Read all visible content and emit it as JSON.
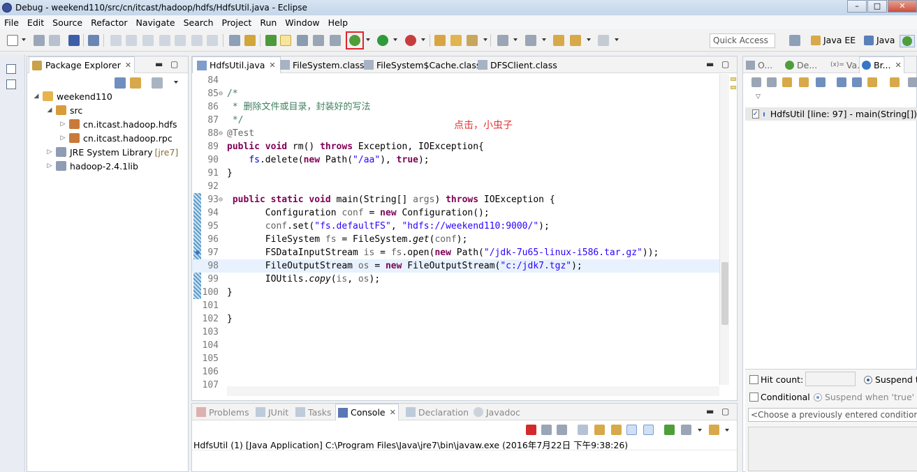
{
  "window": {
    "title": "Debug - weekend110/src/cn/itcast/hadoop/hdfs/HdfsUtil.java - Eclipse"
  },
  "menu": [
    "File",
    "Edit",
    "Source",
    "Refactor",
    "Navigate",
    "Search",
    "Project",
    "Run",
    "Window",
    "Help"
  ],
  "toolbar": {
    "quick_access_placeholder": "Quick Access",
    "perspectives": [
      "Java EE",
      "Java"
    ]
  },
  "package_explorer": {
    "tab_label": "Package Explorer",
    "tree": [
      {
        "label": "weekend110",
        "decor": ""
      },
      {
        "label": "src",
        "decor": ""
      },
      {
        "label": "cn.itcast.hadoop.hdfs",
        "decor": ""
      },
      {
        "label": "cn.itcast.hadoop.rpc",
        "decor": ""
      },
      {
        "label": "JRE System Library",
        "decor": "[jre7]"
      },
      {
        "label": "hadoop-2.4.1lib",
        "decor": ""
      }
    ]
  },
  "editor": {
    "tabs": [
      "HdfsUtil.java",
      "FileSystem.class",
      "FileSystem$Cache.class",
      "DFSClient.class"
    ],
    "annotation": "点击，小虫子",
    "lines": [
      {
        "n": "84",
        "fold": "",
        "code": []
      },
      {
        "n": "85",
        "fold": "⊖",
        "code": [
          [
            "cm",
            "/*"
          ]
        ]
      },
      {
        "n": "86",
        "fold": "",
        "code": [
          [
            "cm",
            " * 删除文件或目录，封装好的写法"
          ]
        ]
      },
      {
        "n": "87",
        "fold": "",
        "code": [
          [
            "cm",
            " */"
          ]
        ]
      },
      {
        "n": "88",
        "fold": "⊖",
        "code": [
          [
            "an",
            "@Test"
          ]
        ]
      },
      {
        "n": "89",
        "fold": "",
        "code": [
          [
            "kw",
            "public"
          ],
          [
            "",
            " "
          ],
          [
            "kw",
            "void"
          ],
          [
            "",
            " rm() "
          ],
          [
            "kw",
            "throws"
          ],
          [
            "",
            " Exception, IOException{"
          ]
        ]
      },
      {
        "n": "90",
        "fold": "",
        "code": [
          [
            "",
            "    "
          ],
          [
            "fld",
            "fs"
          ],
          [
            "",
            ".delete("
          ],
          [
            "kw",
            "new"
          ],
          [
            "",
            " Path("
          ],
          [
            "str",
            "\"/aa\""
          ],
          [
            "",
            "), "
          ],
          [
            "kw",
            "true"
          ],
          [
            "",
            ");"
          ]
        ]
      },
      {
        "n": "91",
        "fold": "",
        "code": [
          [
            "",
            "}"
          ]
        ]
      },
      {
        "n": "92",
        "fold": "",
        "code": []
      },
      {
        "n": "93",
        "fold": "⊖",
        "code": [
          [
            "",
            " "
          ],
          [
            "kw",
            "public"
          ],
          [
            "",
            " "
          ],
          [
            "kw",
            "static"
          ],
          [
            "",
            " "
          ],
          [
            "kw",
            "void"
          ],
          [
            "",
            " main(String[] "
          ],
          [
            "an",
            "args"
          ],
          [
            "",
            ") "
          ],
          [
            "kw",
            "throws"
          ],
          [
            "",
            " IOException {"
          ]
        ]
      },
      {
        "n": "94",
        "fold": "",
        "code": [
          [
            "",
            "       Configuration "
          ],
          [
            "an",
            "conf"
          ],
          [
            "",
            " = "
          ],
          [
            "kw",
            "new"
          ],
          [
            "",
            " Configuration();"
          ]
        ]
      },
      {
        "n": "95",
        "fold": "",
        "code": [
          [
            "",
            "       "
          ],
          [
            "an",
            "conf"
          ],
          [
            "",
            ".set("
          ],
          [
            "str",
            "\"fs.defaultFS\""
          ],
          [
            "",
            ", "
          ],
          [
            "str",
            "\"hdfs://weekend110:9000/\""
          ],
          [
            "",
            ");"
          ]
        ]
      },
      {
        "n": "96",
        "fold": "",
        "code": [
          [
            "",
            "       FileSystem "
          ],
          [
            "an",
            "fs"
          ],
          [
            "",
            " = FileSystem."
          ],
          [
            "it",
            "get"
          ],
          [
            "",
            "("
          ],
          [
            "an",
            "conf"
          ],
          [
            "",
            ");"
          ]
        ]
      },
      {
        "n": "97",
        "fold": "",
        "code": [
          [
            "",
            "       FSDataInputStream "
          ],
          [
            "an",
            "is"
          ],
          [
            "",
            " = "
          ],
          [
            "an",
            "fs"
          ],
          [
            "",
            ".open("
          ],
          [
            "kw",
            "new"
          ],
          [
            "",
            " Path("
          ],
          [
            "str",
            "\"/jdk-7u65-linux-i586.tar.gz\""
          ],
          [
            "",
            "));"
          ]
        ]
      },
      {
        "n": "98",
        "fold": "",
        "code": [
          [
            "",
            "       FileOutputStream "
          ],
          [
            "an",
            "os"
          ],
          [
            "",
            " = "
          ],
          [
            "kw",
            "new"
          ],
          [
            "",
            " FileOutputStream("
          ],
          [
            "str",
            "\"c:/jdk7.tgz\""
          ],
          [
            "",
            ");"
          ]
        ]
      },
      {
        "n": "99",
        "fold": "",
        "code": [
          [
            "",
            "       IOUtils."
          ],
          [
            "it",
            "copy"
          ],
          [
            "",
            "("
          ],
          [
            "an",
            "is"
          ],
          [
            "",
            ", "
          ],
          [
            "an",
            "os"
          ],
          [
            "",
            ");"
          ]
        ]
      },
      {
        "n": "100",
        "fold": "",
        "code": [
          [
            "",
            "}"
          ]
        ]
      },
      {
        "n": "101",
        "fold": "",
        "code": []
      },
      {
        "n": "102",
        "fold": "",
        "code": [
          [
            "",
            "}"
          ]
        ]
      },
      {
        "n": "103",
        "fold": "",
        "code": []
      },
      {
        "n": "104",
        "fold": "",
        "code": []
      },
      {
        "n": "105",
        "fold": "",
        "code": []
      },
      {
        "n": "106",
        "fold": "",
        "code": []
      },
      {
        "n": "107",
        "fold": "",
        "code": []
      }
    ]
  },
  "console": {
    "tabs": [
      "Problems",
      "JUnit",
      "Tasks",
      "Console",
      "Declaration",
      "Javadoc"
    ],
    "status": "HdfsUtil (1) [Java Application] C:\\Program Files\\Java\\jre7\\bin\\javaw.exe (2016年7月22日 下午9:38:26)"
  },
  "right_panel": {
    "tabs": [
      "O...",
      "De...",
      "Va...",
      "Br..."
    ],
    "tab_prefix_va": "(x)=",
    "breakpoint": "HdfsUtil [line: 97] - main(String[])",
    "hit_count_label": "Hit count:",
    "suspend_thread_label": "Suspend thread",
    "conditional_label": "Conditional",
    "suspend_when_true_label": "Suspend when 'true'",
    "condition_placeholder": "<Choose a previously entered condition>"
  },
  "colors": {
    "accent_red": "#e0262b",
    "keyword": "#7f0055",
    "string": "#2a00ff",
    "comment": "#3f7f5f"
  }
}
